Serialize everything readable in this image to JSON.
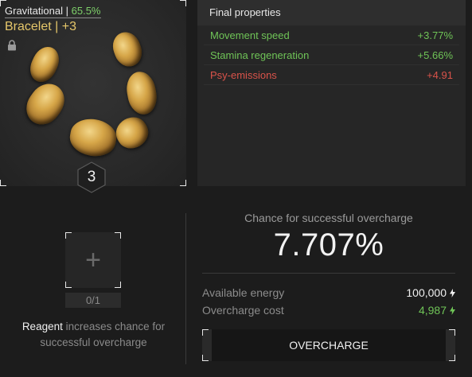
{
  "item": {
    "type_label": "Gravitational",
    "separator": "|",
    "quality_percent": "65.5%",
    "name": "Bracelet",
    "upgrade_level": "+3",
    "badge_number": "3",
    "lock_icon": "lock-icon",
    "name_color": "#e6c76a"
  },
  "final_properties": {
    "title": "Final properties",
    "rows": [
      {
        "name": "Movement speed",
        "value": "+3.77%",
        "kind": "positive"
      },
      {
        "name": "Stamina regeneration",
        "value": "+5.66%",
        "kind": "positive"
      },
      {
        "name": "Psy-emissions",
        "value": "+4.91",
        "kind": "negative"
      }
    ],
    "positive_color": "#6fc457",
    "negative_color": "#d9534a"
  },
  "reagent": {
    "plus_symbol": "+",
    "slot_count": "0/1",
    "text_strong": "Reagent",
    "text_rest": " increases chance for successful overcharge"
  },
  "overcharge": {
    "chance_label": "Chance for successful overcharge",
    "chance_value": "7.707%",
    "available_energy_label": "Available energy",
    "available_energy_value": "100,000",
    "cost_label": "Overcharge cost",
    "cost_value": "4,987",
    "button_label": "OVERCHARGE",
    "energy_icon": "lightning-bolt-icon"
  }
}
